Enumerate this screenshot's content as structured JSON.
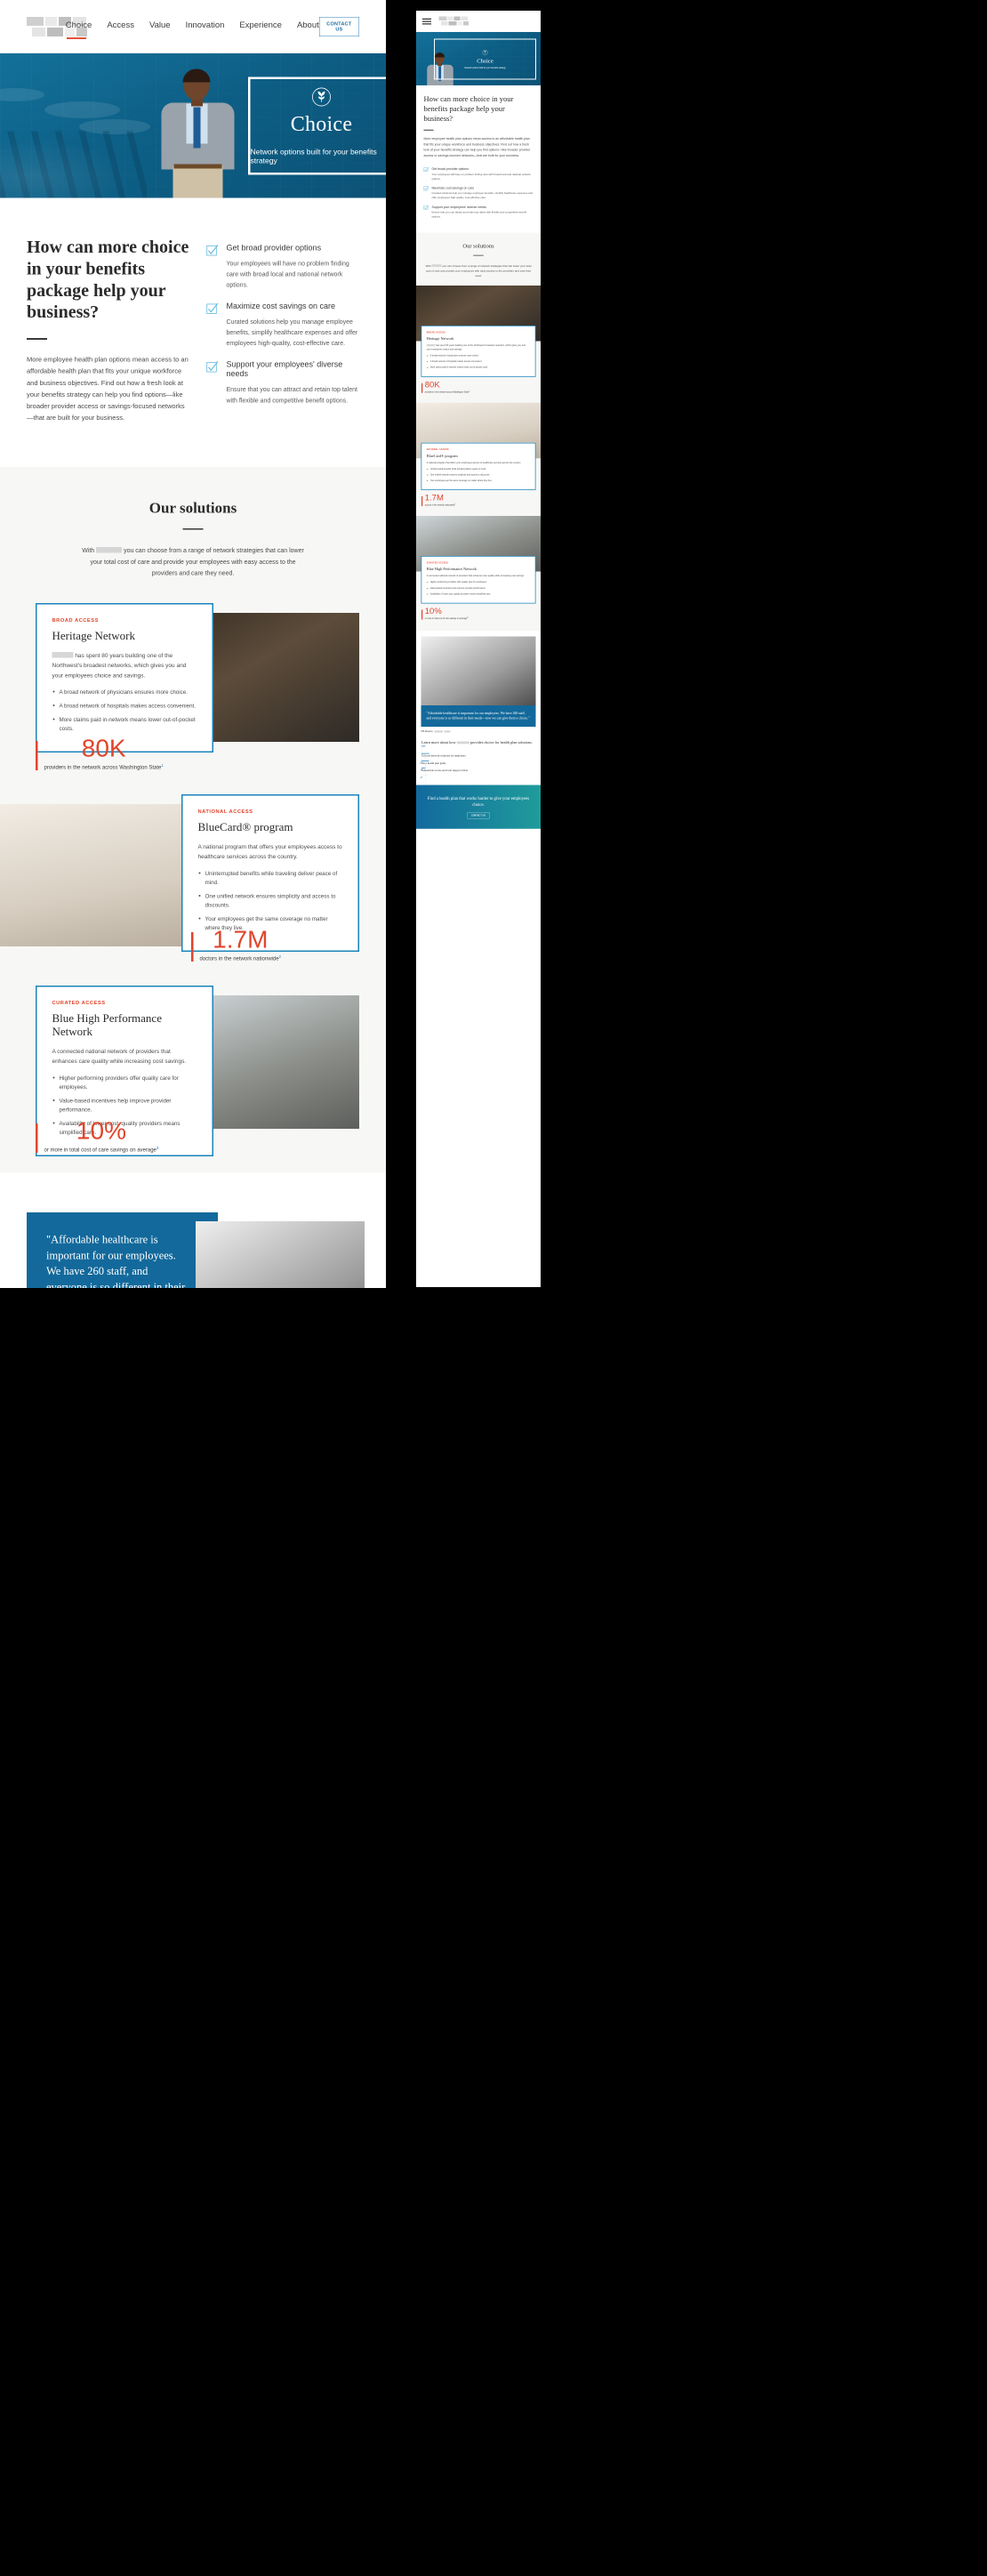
{
  "nav": {
    "logo": "logo-redacted",
    "links": [
      "Choice",
      "Access",
      "Value",
      "Innovation",
      "Experience",
      "About"
    ],
    "active": "Choice",
    "contact_label": "CONTACT US"
  },
  "hero": {
    "icon": "leaf-emblem-icon",
    "title": "Choice",
    "subtitle": "Network options built for your benefits strategy"
  },
  "choice_section": {
    "heading": "How can more choice in your benefits package help your business?",
    "paragraph": "More employee health plan options mean access to an affordable health plan that fits your unique workforce and business objectives. Find out how a fresh look at your benefits strategy can help you find options—like broader provider access or savings-focused networks—that are built for your business.",
    "checklist": [
      {
        "title": "Get broad provider options",
        "text": "Your employees will have no problem finding care with broad local and national network options."
      },
      {
        "title": "Maximize cost savings on care",
        "text": "Curated solutions help you manage employee benefits, simplify healthcare expenses and offer employees high-quality, cost-effective care."
      },
      {
        "title": "Support your employees' diverse needs",
        "text": "Ensure that you can attract and retain top talent with flexible and competitive benefit options."
      }
    ]
  },
  "solutions": {
    "heading": "Our solutions",
    "intro_pre": "With",
    "intro_post": "you can choose from a range of network strategies that can lower your total cost of care and provide your employees with easy access to the providers and care they need."
  },
  "networks": [
    {
      "eyebrow": "BROAD ACCESS",
      "title": "Heritage Network",
      "paragraph_pre": "",
      "paragraph_post": "has spent 80 years building one of the Northwest's broadest networks, which gives you and your employees choice and savings.",
      "bullets": [
        "A broad network of physicians ensures more choice.",
        "A broad network of hospitals makes access convenient.",
        "More claims paid in-network means lower out-of-pocket costs."
      ],
      "stat_number": "80K",
      "stat_caption": "providers in the network across Washington State",
      "stat_sup": "1",
      "photo": "photo-a",
      "side": "left"
    },
    {
      "eyebrow": "NATIONAL ACCESS",
      "title": "BlueCard® program",
      "paragraph_pre": "A national program that offers your employees access to healthcare services across the country.",
      "paragraph_post": "",
      "bullets": [
        "Uninterrupted benefits while traveling deliver peace of mind.",
        "One unified network ensures simplicity and access to discounts.",
        "Your employees get the same coverage no matter where they live."
      ],
      "stat_number": "1.7M",
      "stat_caption": "doctors in the network nationwide",
      "stat_sup": "2",
      "photo": "photo-b",
      "side": "right"
    },
    {
      "eyebrow": "CURATED ACCESS",
      "title": "Blue High Performance Network",
      "paragraph_pre": "A connected national network of providers that enhances care quality while increasing cost savings.",
      "paragraph_post": "",
      "bullets": [
        "Higher performing providers offer quality care for employees.",
        "Value-based incentives help improve provider performance.",
        "Availability of lower-cost, quality providers means simplified care."
      ],
      "stat_number": "10%",
      "stat_caption": "or more in total cost of care savings on average",
      "stat_sup": "3",
      "photo": "photo-c",
      "side": "left"
    }
  ],
  "quote": {
    "text": "\"Affordable healthcare is important for our employees. We have 260 staff, and everyone is so different in their needs—now we can give them a choice.\"",
    "attribution_label": "HR Director,",
    "attribution_redacted": "company-name-redacted"
  },
  "learn": {
    "heading_pre": "Learn more about how",
    "heading_post": "provides choice for health plan solutions.",
    "cards": [
      {
        "title": "Tailored network solutions for employers",
        "arrow": "arrow-up-right-icon"
      },
      {
        "title": "2021 health plan guide",
        "arrow": "arrow-up-right-icon"
      },
      {
        "title": "Nationwide access and local support article",
        "arrow": "arrow-up-right-icon"
      }
    ]
  },
  "cta": {
    "heading": "Find a health plan that works harder to give your employees choice.",
    "button_label": "CONTACT US"
  },
  "colors": {
    "brand_blue": "#1b83bb",
    "hero_blue": "#0e6189",
    "accent_red": "#e0452c",
    "cta_gradient_start": "#12699d",
    "cta_gradient_end": "#1f9c9b",
    "bg_grey": "#f7f7f5"
  },
  "mobile": {
    "menu_icon": "hamburger-menu-icon"
  }
}
